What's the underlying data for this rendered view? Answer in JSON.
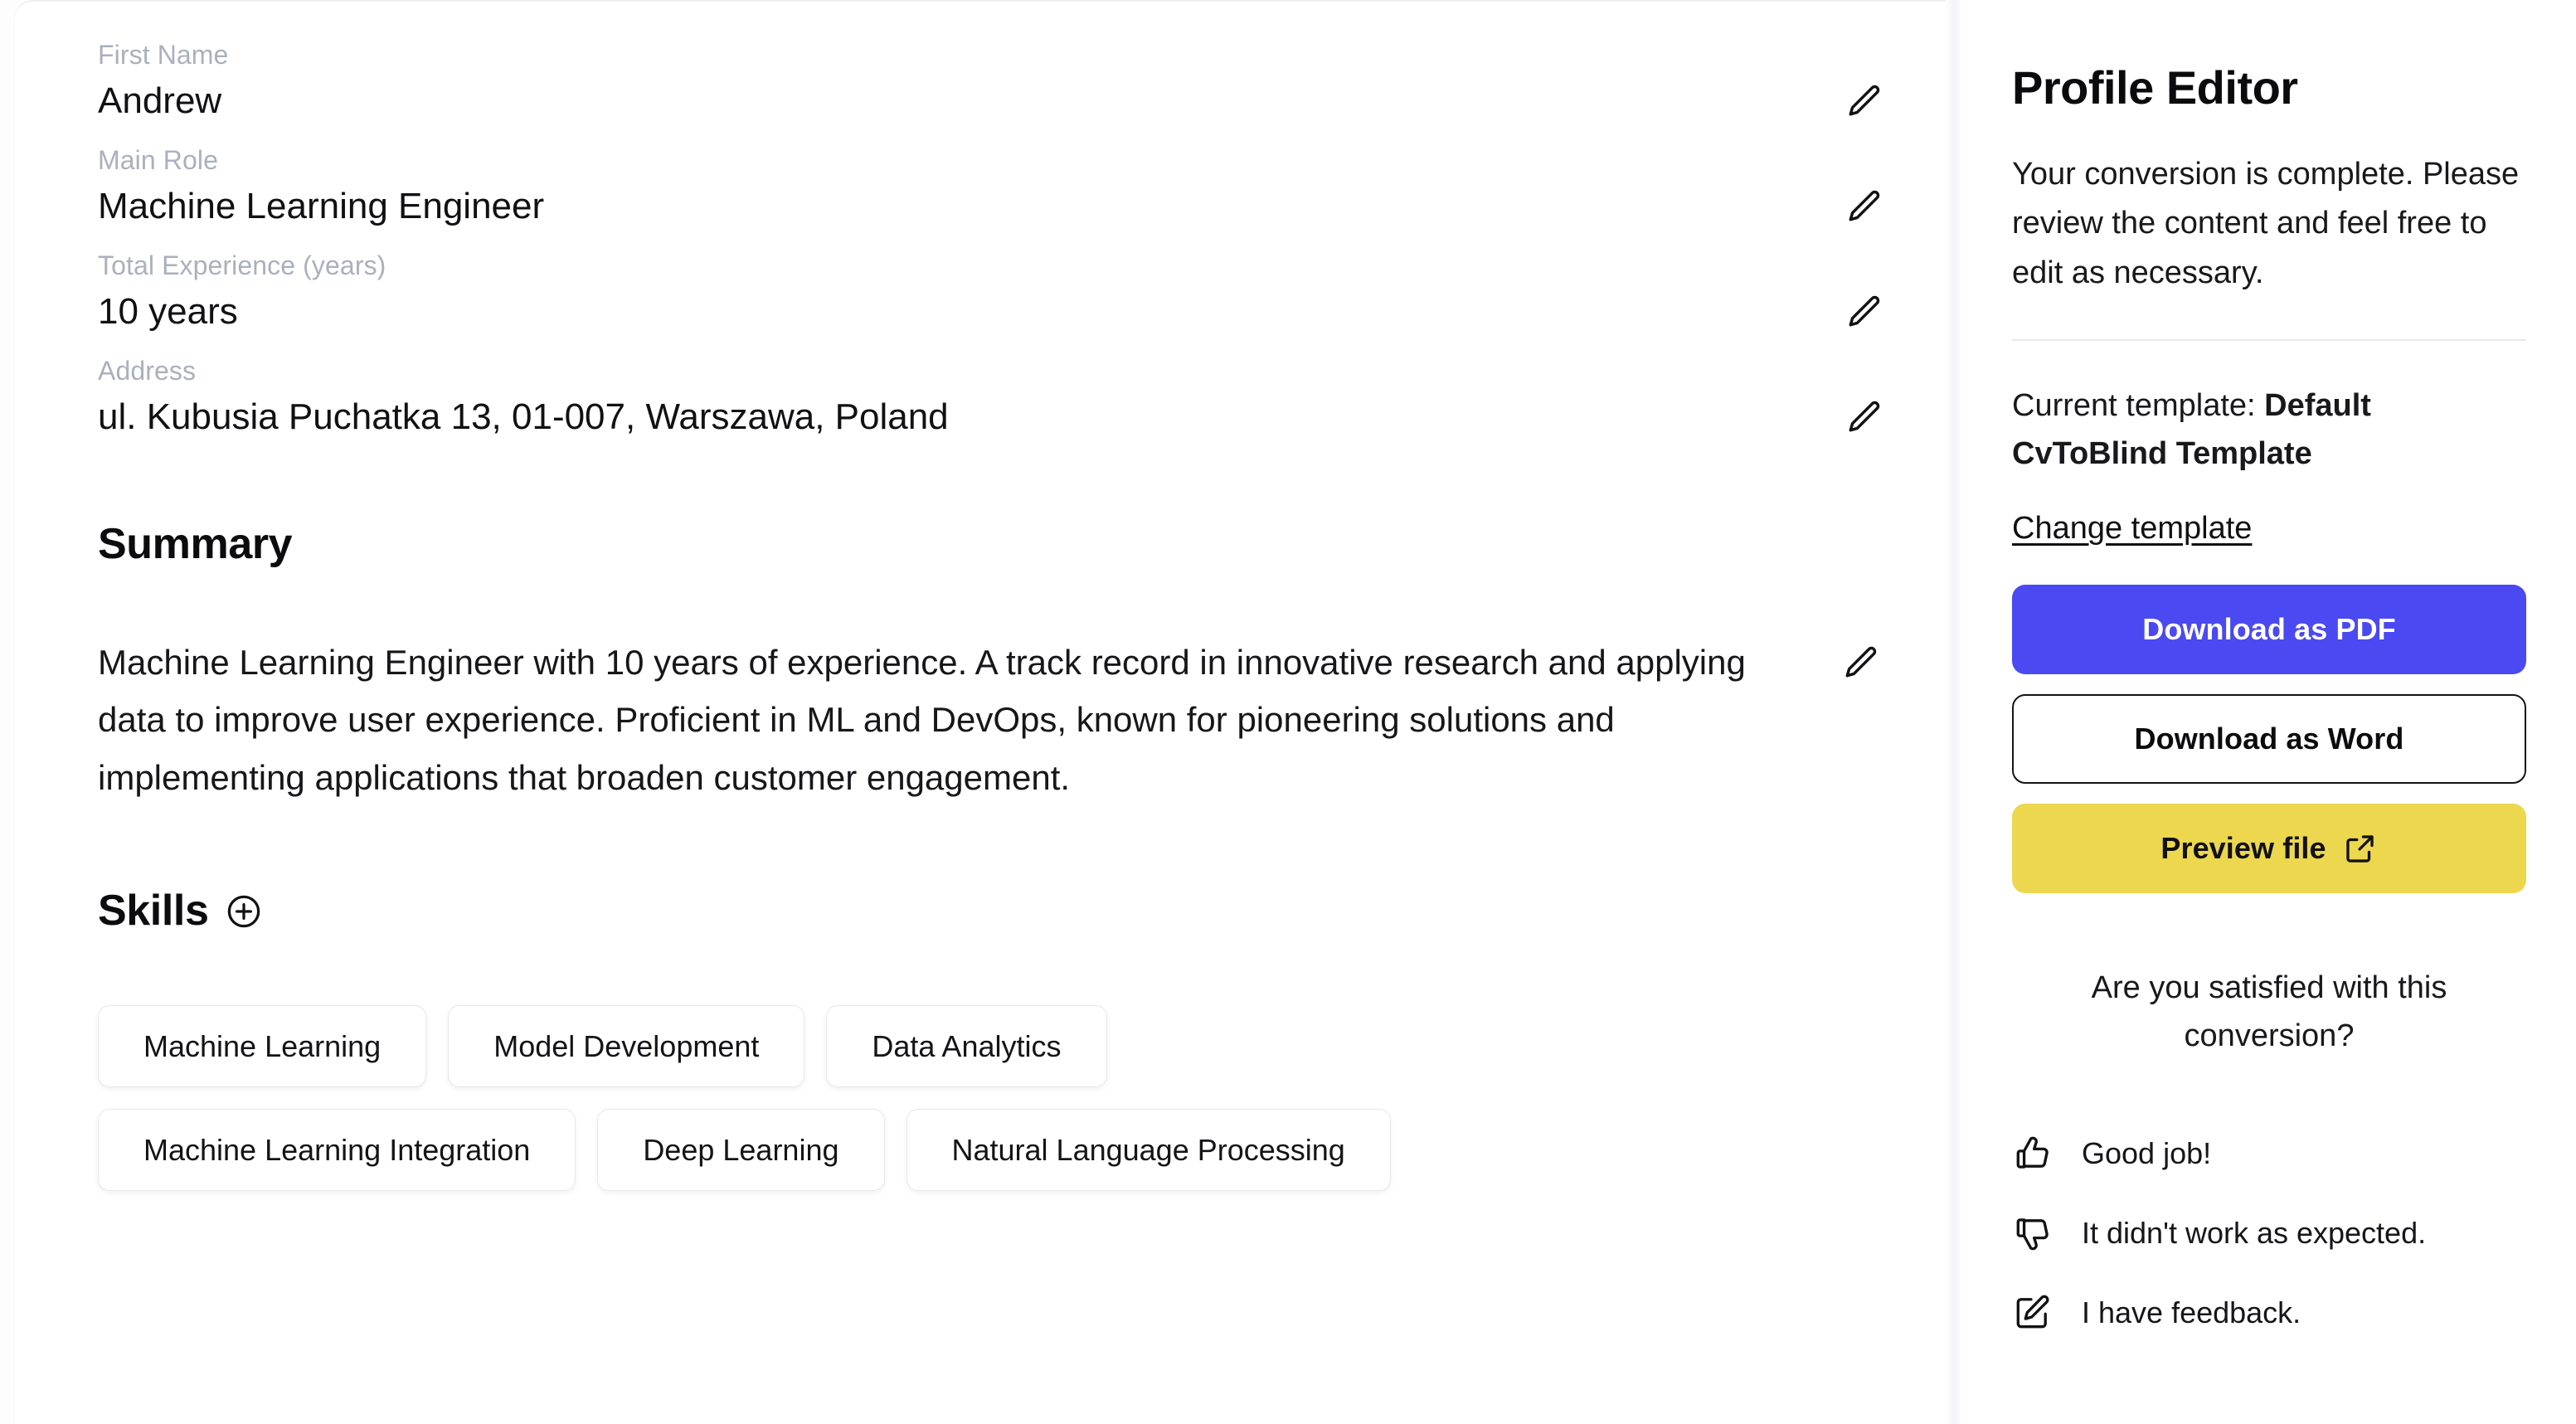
{
  "editor": {
    "fields": [
      {
        "label": "First Name",
        "value": "Andrew",
        "edit_icon": "pencil-icon"
      },
      {
        "label": "Main Role",
        "value": "Machine Learning Engineer",
        "edit_icon": "pencil-icon"
      },
      {
        "label": "Total Experience (years)",
        "value": "10 years",
        "edit_icon": "pencil-icon"
      },
      {
        "label": "Address",
        "value": "ul. Kubusia Puchatka 13, 01-007, Warszawa, Poland",
        "edit_icon": "pencil-icon"
      }
    ],
    "summary": {
      "heading": "Summary",
      "text": "Machine Learning Engineer with 10 years of experience. A track record in innovative research and applying data to improve user experience. Proficient in ML and DevOps, known for pioneering solutions and implementing applications that broaden customer engagement.",
      "edit_icon": "pencil-icon"
    },
    "skills": {
      "heading": "Skills",
      "add_icon": "plus-circle-icon",
      "rows": [
        [
          "Machine Learning",
          "Model Development",
          "Data Analytics"
        ],
        [
          "Machine Learning Integration",
          "Deep Learning",
          "Natural Language Processing"
        ]
      ]
    }
  },
  "sidebar": {
    "title": "Profile Editor",
    "description": "Your conversion is complete. Please review the content and feel free to edit as necessary.",
    "template_prefix": "Current template: ",
    "template_name": "Default CvToBlind Template",
    "change_template_label": "Change template",
    "buttons": {
      "pdf": "Download as PDF",
      "word": "Download as Word",
      "preview": "Preview file",
      "preview_icon": "external-link-icon"
    },
    "feedback": {
      "question": "Are you satisfied with this conversion?",
      "options": [
        {
          "label": "Good job!",
          "icon": "thumbs-up-icon"
        },
        {
          "label": "It didn't work as expected.",
          "icon": "thumbs-down-icon"
        },
        {
          "label": "I have feedback.",
          "icon": "pencil-square-icon"
        }
      ]
    }
  },
  "colors": {
    "pdf_button": "#4b49f2",
    "preview_button": "#ecd74e",
    "label_text": "#aab0bd",
    "body_text": "#17171a"
  }
}
